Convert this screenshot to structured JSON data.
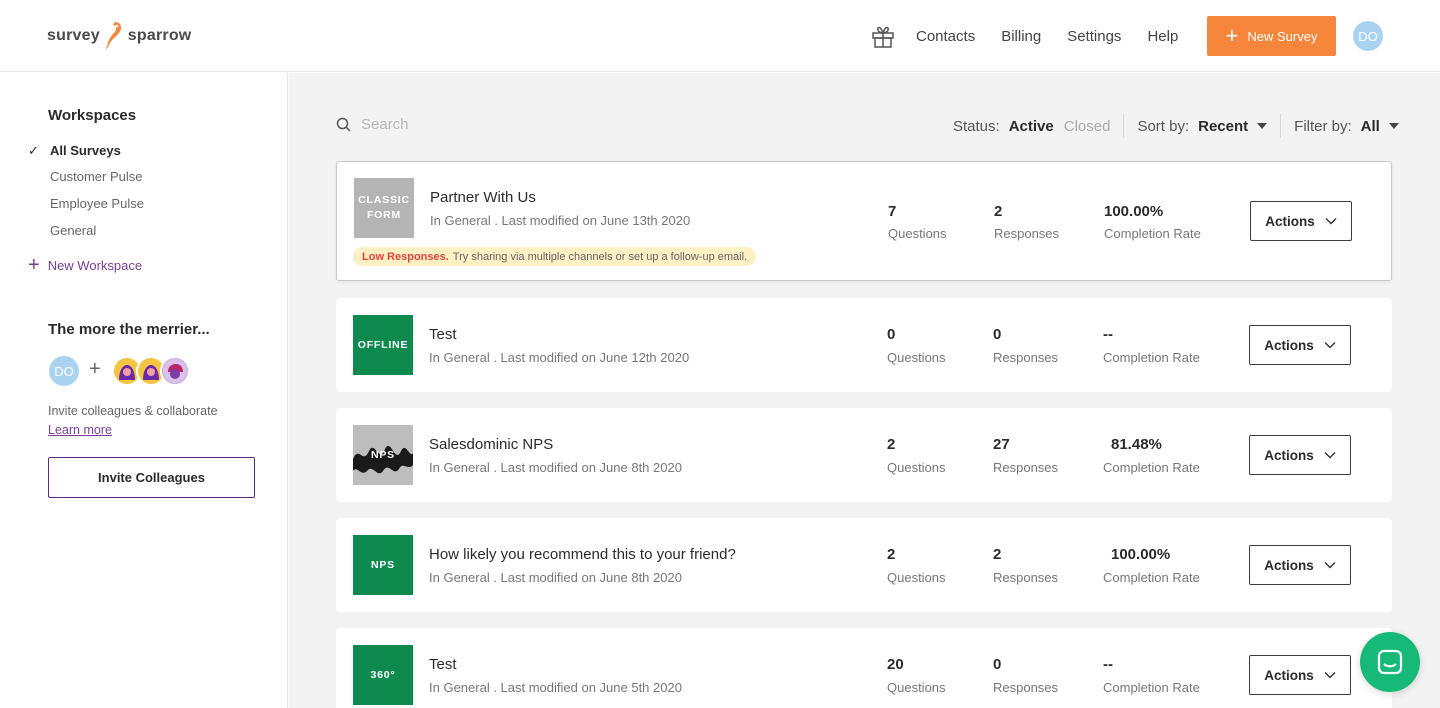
{
  "brand": {
    "logo_left": "survey",
    "logo_right": "sparrow",
    "accent": "#f5863b",
    "purple": "#7b3f98"
  },
  "nav": {
    "items": [
      "Contacts",
      "Billing",
      "Settings",
      "Help"
    ],
    "new_survey": "New Survey",
    "avatar": "DO"
  },
  "sidebar": {
    "workspaces_title": "Workspaces",
    "items": [
      "All Surveys",
      "Customer Pulse",
      "Employee Pulse",
      "General"
    ],
    "active": "All Surveys",
    "new_workspace": "New Workspace",
    "merrier_title": "The more the merrier...",
    "avatar": "DO",
    "invite_text": "Invite colleagues & collaborate",
    "learn_more": "Learn more",
    "invite_button": "Invite Colleagues"
  },
  "toolbar": {
    "search_placeholder": "Search",
    "status_label": "Status:",
    "status_active": "Active",
    "status_closed": "Closed",
    "sort_label": "Sort by:",
    "sort_value": "Recent",
    "filter_label": "Filter by:",
    "filter_value": "All"
  },
  "stat_labels": {
    "questions": "Questions",
    "responses": "Responses",
    "completion": "Completion Rate"
  },
  "surveys": [
    {
      "thumb": "CLASSIC FORM",
      "title": "Partner With Us",
      "meta": "In General . Last modified on June 13th 2020",
      "questions": "7",
      "responses": "2",
      "completion": "100.00%",
      "warning_bold": "Low Responses.",
      "warning_text": "Try sharing via multiple channels or set up a follow-up email.",
      "actions": "Actions"
    },
    {
      "thumb": "OFFLINE",
      "title": "Test",
      "meta": "In General . Last modified on June 12th 2020",
      "questions": "0",
      "responses": "0",
      "completion": "--",
      "actions": "Actions"
    },
    {
      "thumb": "NPS",
      "title": "Salesdominic NPS",
      "meta": "In General . Last modified on June 8th 2020",
      "questions": "2",
      "responses": "27",
      "completion": "81.48%",
      "actions": "Actions"
    },
    {
      "thumb": "NPS",
      "title": "How likely you recommend this to your friend?",
      "meta": "In General . Last modified on June 8th 2020",
      "questions": "2",
      "responses": "2",
      "completion": "100.00%",
      "actions": "Actions"
    },
    {
      "thumb": "360°",
      "title": "Test",
      "meta": "In General . Last modified on June 5th 2020",
      "questions": "20",
      "responses": "0",
      "completion": "--",
      "actions": "Actions"
    }
  ]
}
